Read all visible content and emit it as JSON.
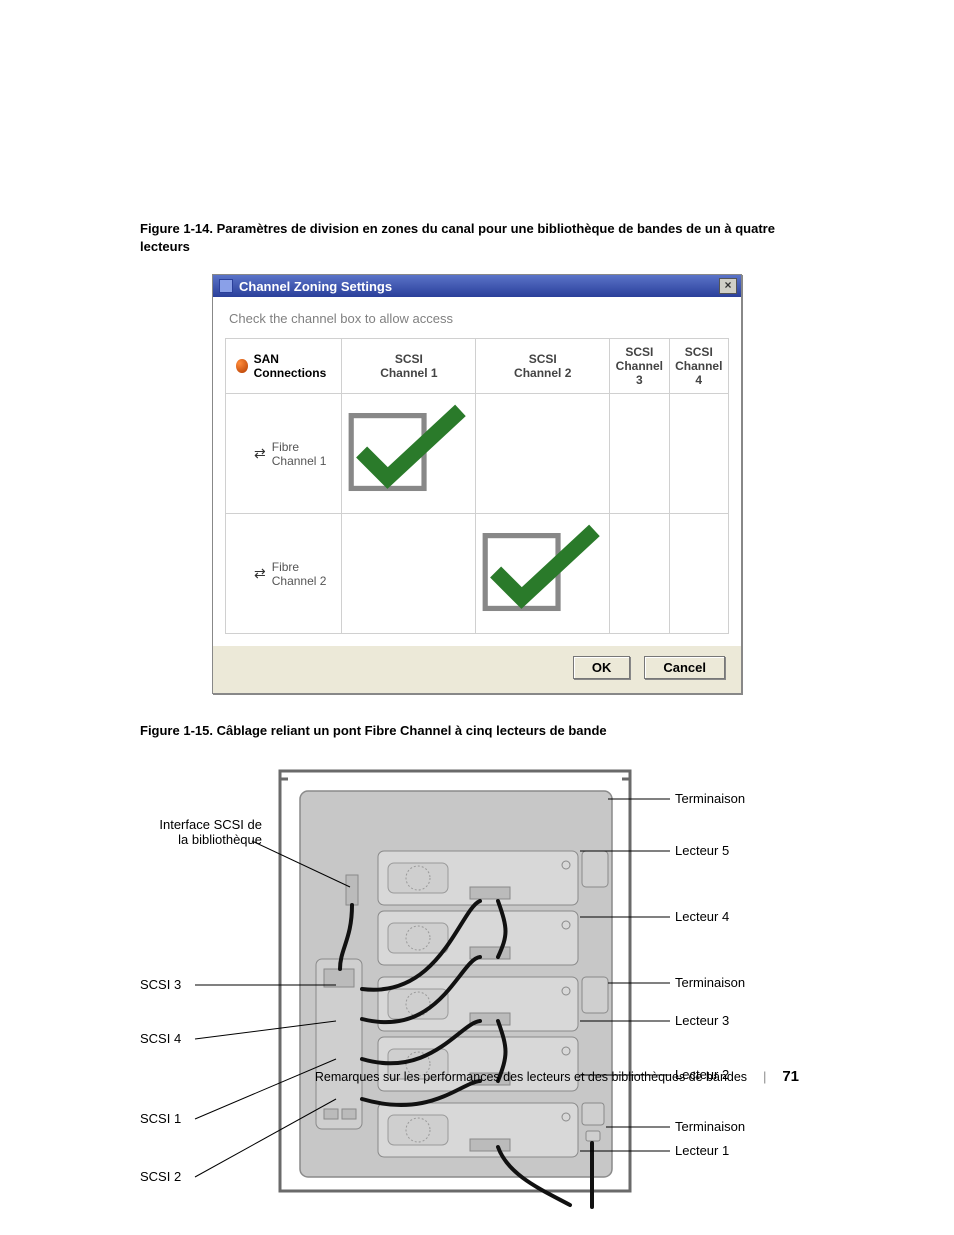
{
  "figure1": {
    "caption": "Figure 1-14.    Paramètres de division en zones du canal pour une bibliothèque de bandes de un à quatre lecteurs"
  },
  "dialog": {
    "title": "Channel Zoning Settings",
    "hint": "Check the channel box to allow access",
    "row_header": "SAN Connections",
    "cols": [
      {
        "t": "SCSI",
        "b": "Channel 1"
      },
      {
        "t": "SCSI",
        "b": "Channel 2"
      },
      {
        "t": "SCSI",
        "b": "Channel 3"
      },
      {
        "t": "SCSI",
        "b": "Channel 4"
      }
    ],
    "rows": [
      {
        "label": "Fibre Channel 1",
        "checked_col": 0
      },
      {
        "label": "Fibre Channel 2",
        "checked_col": 1
      }
    ],
    "ok": "OK",
    "cancel": "Cancel"
  },
  "figure2": {
    "caption": "Figure 1-15.    Câblage reliant un pont Fibre Channel à cinq lecteurs de bande"
  },
  "diagram_labels": {
    "iface1": "Interface SCSI de",
    "iface2": "la bibliothèque",
    "scsi3": "SCSI 3",
    "scsi4": "SCSI 4",
    "scsi1": "SCSI 1",
    "scsi2": "SCSI 2",
    "term1": "Terminaison",
    "lec5": "Lecteur 5",
    "lec4": "Lecteur 4",
    "term2": "Terminaison",
    "lec3": "Lecteur 3",
    "lec2": "Lecteur 2",
    "term3": "Terminaison",
    "lec1": "Lecteur 1"
  },
  "footer": {
    "text": "Remarques sur les performances des lecteurs et des bibliothèques de bandes",
    "page": "71"
  }
}
